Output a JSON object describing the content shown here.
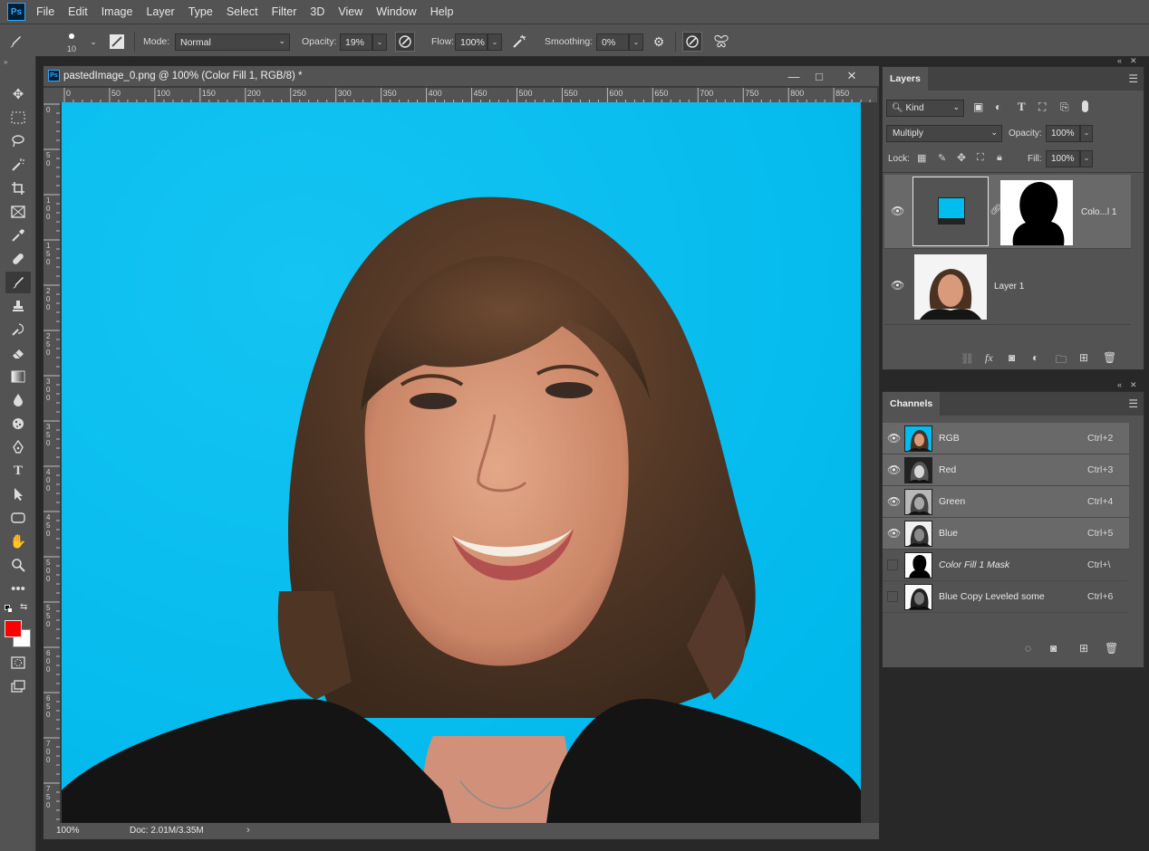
{
  "app": {
    "logo": "Ps",
    "menus": [
      "File",
      "Edit",
      "Image",
      "Layer",
      "Type",
      "Select",
      "Filter",
      "3D",
      "View",
      "Window",
      "Help"
    ]
  },
  "options": {
    "brush_size": "10",
    "mode_label": "Mode:",
    "mode_value": "Normal",
    "opacity_label": "Opacity:",
    "opacity_value": "19%",
    "flow_label": "Flow:",
    "flow_value": "100%",
    "smoothing_label": "Smoothing:",
    "smoothing_value": "0%"
  },
  "document": {
    "title": "pastedImage_0.png @ 100% (Color Fill 1, RGB/8) *",
    "zoom": "100%",
    "doc_info": "Doc: 2.01M/3.35M",
    "hruler_ticks": [
      "0",
      "50",
      "100",
      "150",
      "200",
      "250",
      "300",
      "350",
      "400",
      "450",
      "500",
      "550",
      "600",
      "650",
      "700",
      "750",
      "800",
      "850"
    ],
    "vruler_ticks": [
      "0",
      "5\n0",
      "1\n0\n0",
      "1\n5\n0",
      "2\n0\n0",
      "2\n5\n0",
      "3\n0\n0",
      "3\n5\n0",
      "4\n0\n0",
      "4\n5\n0",
      "5\n0\n0",
      "5\n5\n0",
      "6\n0\n0",
      "6\n5\n0",
      "7\n0\n0",
      "7\n5\n0"
    ]
  },
  "layers_panel": {
    "tab": "Layers",
    "filter_kind": "Kind",
    "blend_mode": "Multiply",
    "opacity_label": "Opacity:",
    "opacity_value": "100%",
    "lock_label": "Lock:",
    "fill_label": "Fill:",
    "fill_value": "100%",
    "layers": [
      {
        "name": "Colo...l 1"
      },
      {
        "name": "Layer 1"
      }
    ]
  },
  "channels_panel": {
    "tab": "Channels",
    "channels": [
      {
        "name": "RGB",
        "shortcut": "Ctrl+2"
      },
      {
        "name": "Red",
        "shortcut": "Ctrl+3"
      },
      {
        "name": "Green",
        "shortcut": "Ctrl+4"
      },
      {
        "name": "Blue",
        "shortcut": "Ctrl+5"
      },
      {
        "name": "Color Fill 1 Mask",
        "shortcut": "Ctrl+\\"
      },
      {
        "name": "Blue Copy Leveled some",
        "shortcut": "Ctrl+6"
      }
    ]
  },
  "colors": {
    "foreground": "#ff0000",
    "background": "#ffffff",
    "fill_color": "#00bdf0"
  }
}
